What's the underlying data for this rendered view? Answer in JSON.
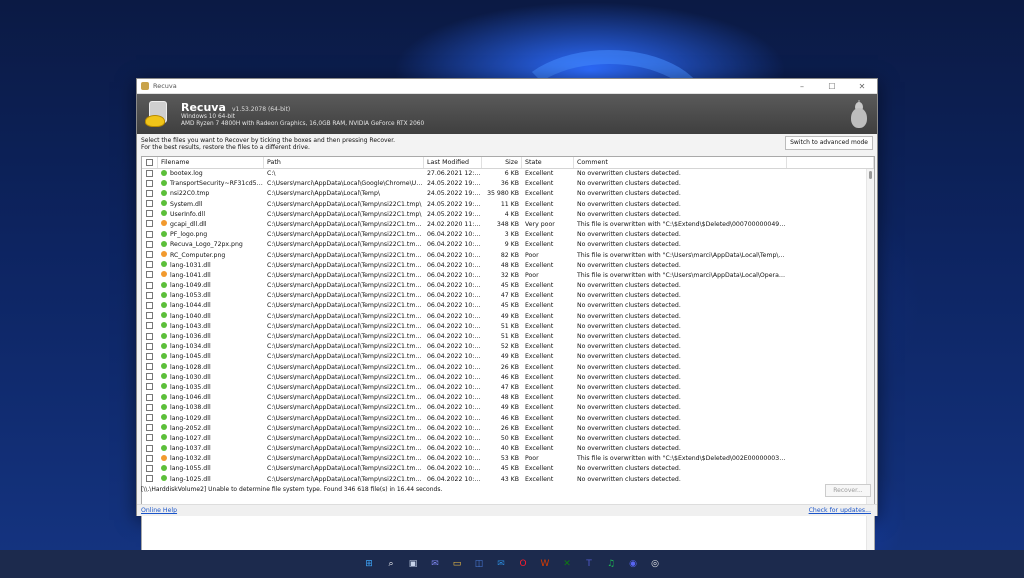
{
  "window": {
    "title": "Recuva",
    "minimize_glyph": "–",
    "maximize_glyph": "☐",
    "close_glyph": "✕"
  },
  "header": {
    "app_name": "Recuva",
    "version": "v1.53.2078 (64-bit)",
    "os": "Windows 10 64-bit",
    "hardware": "AMD Ryzen 7 4800H with Radeon Graphics, 16,0GB RAM, NVIDIA GeForce RTX 2060"
  },
  "instructions": {
    "line1": "Select the files you want to Recover by ticking the boxes and then pressing Recover.",
    "line2": "For the best results, restore the files to a different drive.",
    "advanced_button": "Switch to advanced mode"
  },
  "columns": {
    "filename": "Filename",
    "path": "Path",
    "last_modified": "Last Modified",
    "size": "Size",
    "state": "State",
    "comment": "Comment"
  },
  "state_colors": {
    "Excellent": "#5cbf3a",
    "Poor": "#f29a2e",
    "Very poor": "#f29a2e"
  },
  "rows": [
    {
      "name": "bootex.log",
      "path": "C:\\",
      "modified": "27.06.2021 12:56",
      "size": "6 KB",
      "state": "Excellent",
      "comment": "No overwritten clusters detected."
    },
    {
      "name": "TransportSecurity~RF31cd5e8f...",
      "path": "C:\\Users\\marci\\AppData\\Local\\Google\\Chrome\\Use...",
      "modified": "24.05.2022 19:23",
      "size": "36 KB",
      "state": "Excellent",
      "comment": "No overwritten clusters detected."
    },
    {
      "name": "nsi22C0.tmp",
      "path": "C:\\Users\\marci\\AppData\\Local\\Temp\\",
      "modified": "24.05.2022 19:23",
      "size": "35 980 KB",
      "state": "Excellent",
      "comment": "No overwritten clusters detected."
    },
    {
      "name": "System.dll",
      "path": "C:\\Users\\marci\\AppData\\Local\\Temp\\nsi22C1.tmp\\",
      "modified": "24.05.2022 19:23",
      "size": "11 KB",
      "state": "Excellent",
      "comment": "No overwritten clusters detected."
    },
    {
      "name": "UserInfo.dll",
      "path": "C:\\Users\\marci\\AppData\\Local\\Temp\\nsi22C1.tmp\\",
      "modified": "24.05.2022 19:23",
      "size": "4 KB",
      "state": "Excellent",
      "comment": "No overwritten clusters detected."
    },
    {
      "name": "gcapi_dll.dll",
      "path": "C:\\Users\\marci\\AppData\\Local\\Temp\\nsi22C1.tmp\\g\\",
      "modified": "24.02.2020 11:42",
      "size": "348 KB",
      "state": "Very poor",
      "comment": "This file is overwritten with \"C:\\$Extend\\$Deleted\\000700000049571424..."
    },
    {
      "name": "PF_logo.png",
      "path": "C:\\Users\\marci\\AppData\\Local\\Temp\\nsi22C1.tmp\\...",
      "modified": "06.04.2022 10:22",
      "size": "3 KB",
      "state": "Excellent",
      "comment": "No overwritten clusters detected."
    },
    {
      "name": "Recuva_Logo_72px.png",
      "path": "C:\\Users\\marci\\AppData\\Local\\Temp\\nsi22C1.tmp\\...",
      "modified": "06.04.2022 10:22",
      "size": "9 KB",
      "state": "Excellent",
      "comment": "No overwritten clusters detected."
    },
    {
      "name": "RC_Computer.png",
      "path": "C:\\Users\\marci\\AppData\\Local\\Temp\\nsi22C1.tmp\\...",
      "modified": "06.04.2022 10:22",
      "size": "82 KB",
      "state": "Poor",
      "comment": "This file is overwritten with \"C:\\Users\\marci\\AppData\\Local\\Temp\\9f9d0..."
    },
    {
      "name": "lang-1031.dll",
      "path": "C:\\Users\\marci\\AppData\\Local\\Temp\\nsi22C1.tmp\\...",
      "modified": "06.04.2022 10:22",
      "size": "48 KB",
      "state": "Excellent",
      "comment": "No overwritten clusters detected."
    },
    {
      "name": "lang-1041.dll",
      "path": "C:\\Users\\marci\\AppData\\Local\\Temp\\nsi22C1.tmp\\...",
      "modified": "06.04.2022 10:22",
      "size": "32 KB",
      "state": "Poor",
      "comment": "This file is overwritten with \"C:\\Users\\marci\\AppData\\Local\\Opera Soft..."
    },
    {
      "name": "lang-1049.dll",
      "path": "C:\\Users\\marci\\AppData\\Local\\Temp\\nsi22C1.tmp\\...",
      "modified": "06.04.2022 10:22",
      "size": "45 KB",
      "state": "Excellent",
      "comment": "No overwritten clusters detected."
    },
    {
      "name": "lang-1053.dll",
      "path": "C:\\Users\\marci\\AppData\\Local\\Temp\\nsi22C1.tmp\\...",
      "modified": "06.04.2022 10:22",
      "size": "47 KB",
      "state": "Excellent",
      "comment": "No overwritten clusters detected."
    },
    {
      "name": "lang-1044.dll",
      "path": "C:\\Users\\marci\\AppData\\Local\\Temp\\nsi22C1.tmp\\...",
      "modified": "06.04.2022 10:22",
      "size": "45 KB",
      "state": "Excellent",
      "comment": "No overwritten clusters detected."
    },
    {
      "name": "lang-1040.dll",
      "path": "C:\\Users\\marci\\AppData\\Local\\Temp\\nsi22C1.tmp\\...",
      "modified": "06.04.2022 10:22",
      "size": "49 KB",
      "state": "Excellent",
      "comment": "No overwritten clusters detected."
    },
    {
      "name": "lang-1043.dll",
      "path": "C:\\Users\\marci\\AppData\\Local\\Temp\\nsi22C1.tmp\\...",
      "modified": "06.04.2022 10:22",
      "size": "51 KB",
      "state": "Excellent",
      "comment": "No overwritten clusters detected."
    },
    {
      "name": "lang-1036.dll",
      "path": "C:\\Users\\marci\\AppData\\Local\\Temp\\nsi22C1.tmp\\...",
      "modified": "06.04.2022 10:22",
      "size": "51 KB",
      "state": "Excellent",
      "comment": "No overwritten clusters detected."
    },
    {
      "name": "lang-1034.dll",
      "path": "C:\\Users\\marci\\AppData\\Local\\Temp\\nsi22C1.tmp\\...",
      "modified": "06.04.2022 10:22",
      "size": "52 KB",
      "state": "Excellent",
      "comment": "No overwritten clusters detected."
    },
    {
      "name": "lang-1045.dll",
      "path": "C:\\Users\\marci\\AppData\\Local\\Temp\\nsi22C1.tmp\\...",
      "modified": "06.04.2022 10:22",
      "size": "49 KB",
      "state": "Excellent",
      "comment": "No overwritten clusters detected."
    },
    {
      "name": "lang-1028.dll",
      "path": "C:\\Users\\marci\\AppData\\Local\\Temp\\nsi22C1.tmp\\...",
      "modified": "06.04.2022 10:22",
      "size": "26 KB",
      "state": "Excellent",
      "comment": "No overwritten clusters detected."
    },
    {
      "name": "lang-1030.dll",
      "path": "C:\\Users\\marci\\AppData\\Local\\Temp\\nsi22C1.tmp\\...",
      "modified": "06.04.2022 10:22",
      "size": "46 KB",
      "state": "Excellent",
      "comment": "No overwritten clusters detected."
    },
    {
      "name": "lang-1035.dll",
      "path": "C:\\Users\\marci\\AppData\\Local\\Temp\\nsi22C1.tmp\\...",
      "modified": "06.04.2022 10:22",
      "size": "47 KB",
      "state": "Excellent",
      "comment": "No overwritten clusters detected."
    },
    {
      "name": "lang-1046.dll",
      "path": "C:\\Users\\marci\\AppData\\Local\\Temp\\nsi22C1.tmp\\...",
      "modified": "06.04.2022 10:22",
      "size": "48 KB",
      "state": "Excellent",
      "comment": "No overwritten clusters detected."
    },
    {
      "name": "lang-1038.dll",
      "path": "C:\\Users\\marci\\AppData\\Local\\Temp\\nsi22C1.tmp\\...",
      "modified": "06.04.2022 10:22",
      "size": "49 KB",
      "state": "Excellent",
      "comment": "No overwritten clusters detected."
    },
    {
      "name": "lang-1029.dll",
      "path": "C:\\Users\\marci\\AppData\\Local\\Temp\\nsi22C1.tmp\\...",
      "modified": "06.04.2022 10:22",
      "size": "46 KB",
      "state": "Excellent",
      "comment": "No overwritten clusters detected."
    },
    {
      "name": "lang-2052.dll",
      "path": "C:\\Users\\marci\\AppData\\Local\\Temp\\nsi22C1.tmp\\...",
      "modified": "06.04.2022 10:22",
      "size": "26 KB",
      "state": "Excellent",
      "comment": "No overwritten clusters detected."
    },
    {
      "name": "lang-1027.dll",
      "path": "C:\\Users\\marci\\AppData\\Local\\Temp\\nsi22C1.tmp\\...",
      "modified": "06.04.2022 10:22",
      "size": "50 KB",
      "state": "Excellent",
      "comment": "No overwritten clusters detected."
    },
    {
      "name": "lang-1037.dll",
      "path": "C:\\Users\\marci\\AppData\\Local\\Temp\\nsi22C1.tmp\\...",
      "modified": "06.04.2022 10:22",
      "size": "40 KB",
      "state": "Excellent",
      "comment": "No overwritten clusters detected."
    },
    {
      "name": "lang-1032.dll",
      "path": "C:\\Users\\marci\\AppData\\Local\\Temp\\nsi22C1.tmp\\...",
      "modified": "06.04.2022 10:22",
      "size": "53 KB",
      "state": "Poor",
      "comment": "This file is overwritten with \"C:\\$Extend\\$Deleted\\002E000000037866717..."
    },
    {
      "name": "lang-1055.dll",
      "path": "C:\\Users\\marci\\AppData\\Local\\Temp\\nsi22C1.tmp\\...",
      "modified": "06.04.2022 10:22",
      "size": "45 KB",
      "state": "Excellent",
      "comment": "No overwritten clusters detected."
    },
    {
      "name": "lang-1025.dll",
      "path": "C:\\Users\\marci\\AppData\\Local\\Temp\\nsi22C1.tmp\\...",
      "modified": "06.04.2022 10:22",
      "size": "43 KB",
      "state": "Excellent",
      "comment": "No overwritten clusters detected."
    }
  ],
  "status_text": "[\\\\.\\HarddiskVolume2] Unable to determine file system type. Found 346 618 file(s) in 16.44 seconds.",
  "recover_button": "Recover...",
  "online_help": "Online Help",
  "check_updates": "Check for updates...",
  "taskbar_icons": [
    "windows-start-icon",
    "search-icon",
    "task-view-icon",
    "teams-chat-icon",
    "file-explorer-icon",
    "store-icon",
    "mail-icon",
    "opera-icon",
    "office-icon",
    "xbox-icon",
    "teams-icon",
    "spotify-icon",
    "discord-icon",
    "chrome-icon"
  ]
}
